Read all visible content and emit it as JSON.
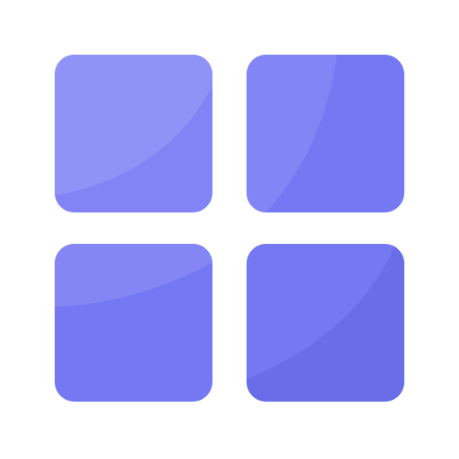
{
  "icon": {
    "name": "grid-icon",
    "colors": {
      "top_left_base": "#8284F6",
      "top_left_highlight": "#8F93F8",
      "top_right_base": "#7479F3",
      "top_right_highlight": "#8285F6",
      "bottom_left_base": "#7478F3",
      "bottom_left_highlight": "#8486F5",
      "bottom_right_base": "#6A6DE8",
      "bottom_right_highlight": "#7579F1"
    }
  }
}
